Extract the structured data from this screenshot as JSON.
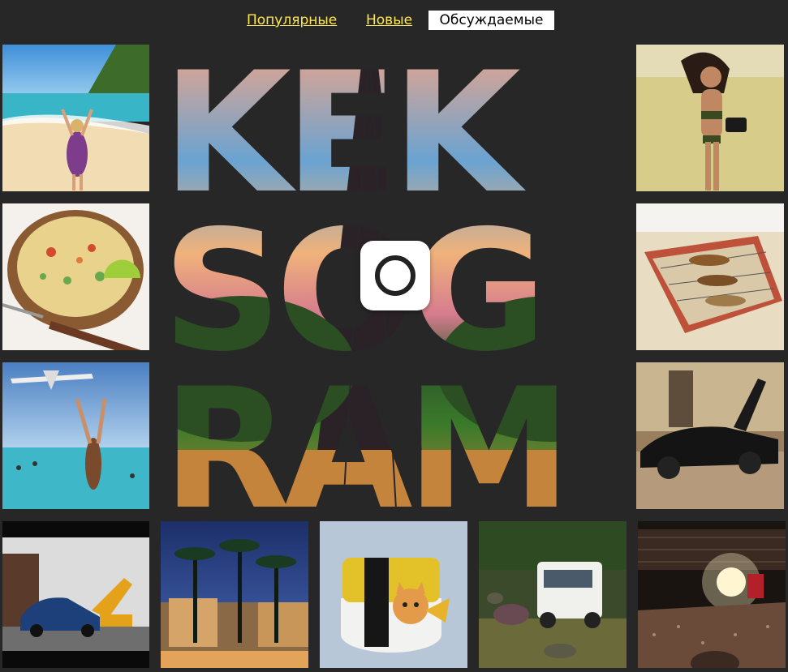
{
  "filters": [
    {
      "label": "Популярные",
      "active": false
    },
    {
      "label": "Новые",
      "active": false
    },
    {
      "label": "Обсуждаемые",
      "active": true
    }
  ],
  "logo": {
    "rows": [
      "KEK",
      "SOG",
      "RAM"
    ],
    "camera_icon": "camera-icon"
  },
  "pictures": [
    {
      "subject": "beach-girl"
    },
    {
      "subject": "salad-bowl"
    },
    {
      "subject": "airplane-beach"
    },
    {
      "subject": "car-demolition"
    },
    {
      "subject": "palm-trees-night"
    },
    {
      "subject": "sushi-cat"
    },
    {
      "subject": "jeep-hippo"
    },
    {
      "subject": "concert-hall"
    },
    {
      "subject": "bikini-camera"
    },
    {
      "subject": "shoe-rack"
    },
    {
      "subject": "black-supercar"
    }
  ],
  "colors": {
    "background": "#272727",
    "filter_link": "#ffe753",
    "filter_active_bg": "#ffffff"
  }
}
